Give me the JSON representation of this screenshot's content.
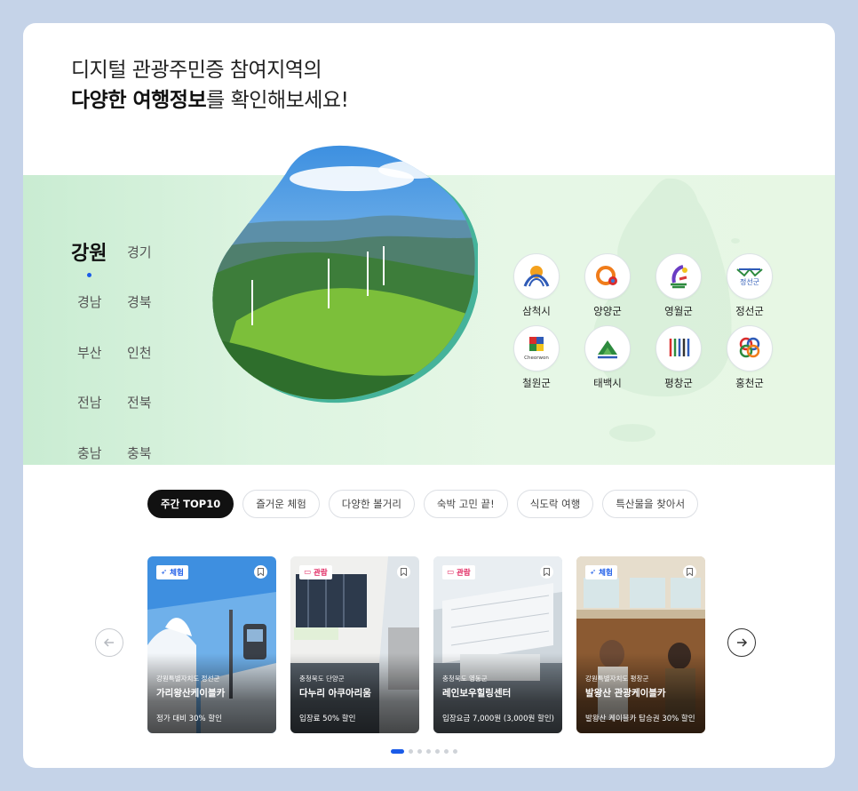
{
  "headline": {
    "line1": "디지털 관광주민증 참여지역의",
    "bold": "다양한 여행정보",
    "rest": "를 확인해보세요!"
  },
  "regions": [
    {
      "label": "강원",
      "active": true
    },
    {
      "label": "경기"
    },
    {
      "label": "경남"
    },
    {
      "label": "경북"
    },
    {
      "label": "부산"
    },
    {
      "label": "인천"
    },
    {
      "label": "전남"
    },
    {
      "label": "전북"
    },
    {
      "label": "충남"
    },
    {
      "label": "충북"
    }
  ],
  "areas": [
    {
      "name": "삼척시"
    },
    {
      "name": "양양군"
    },
    {
      "name": "영월군"
    },
    {
      "name": "정선군",
      "logo_text": "정선군"
    },
    {
      "name": "철원군",
      "logo_text": "Cheorwon"
    },
    {
      "name": "태백시"
    },
    {
      "name": "평창군"
    },
    {
      "name": "홍천군"
    }
  ],
  "tabs": [
    {
      "label": "주간 TOP10",
      "active": true
    },
    {
      "label": "즐거운 체험"
    },
    {
      "label": "다양한 볼거리"
    },
    {
      "label": "숙박 고민 끝!"
    },
    {
      "label": "식도락 여행"
    },
    {
      "label": "특산물을 찾아서"
    }
  ],
  "cards": [
    {
      "badge": "체험",
      "location": "강원특별자치도 정선군",
      "title": "가리왕산케이블카",
      "desc": "정가 대비 30% 할인"
    },
    {
      "badge": "관람",
      "location": "충청북도 단양군",
      "title": "다누리 아쿠아리움",
      "desc": "입장료 50% 할인"
    },
    {
      "badge": "관람",
      "location": "충청북도 영동군",
      "title": "레인보우힐링센터",
      "desc": "입장요금 7,000원 (3,000원 할인)"
    },
    {
      "badge": "체험",
      "location": "강원특별자치도 평창군",
      "title": "발왕산 관광케이블카",
      "desc": "발왕산 케이블카 탑승권 30% 할인"
    }
  ],
  "pagination": {
    "count": 7,
    "active": 1
  },
  "colors": {
    "accent": "#1a5be8",
    "band": "#e2f6e2",
    "tour_badge": "#e0245e",
    "page_bg": "#c5d3e8"
  }
}
